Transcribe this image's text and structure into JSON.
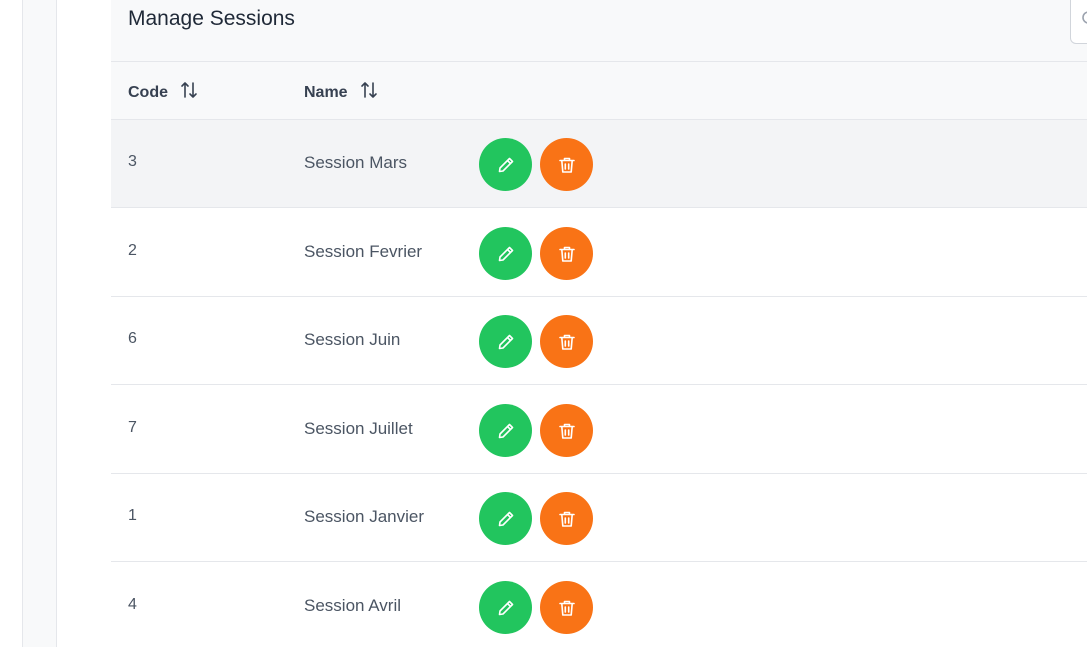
{
  "header": {
    "title": "Manage Sessions"
  },
  "table": {
    "columns": [
      {
        "label": "Code"
      },
      {
        "label": "Name"
      }
    ],
    "rows": [
      {
        "code": "3",
        "name": "Session Mars"
      },
      {
        "code": "2",
        "name": "Session Fevrier"
      },
      {
        "code": "6",
        "name": "Session Juin"
      },
      {
        "code": "7",
        "name": "Session Juillet"
      },
      {
        "code": "1",
        "name": "Session Janvier"
      },
      {
        "code": "4",
        "name": "Session Avril"
      }
    ]
  },
  "icons": {
    "sort": "sort-icon",
    "edit": "pencil-icon",
    "delete": "trash-icon",
    "search": "search-icon"
  },
  "colors": {
    "edit_button": "#22c55e",
    "delete_button": "#f97316",
    "row_highlight": "#f3f4f6"
  }
}
